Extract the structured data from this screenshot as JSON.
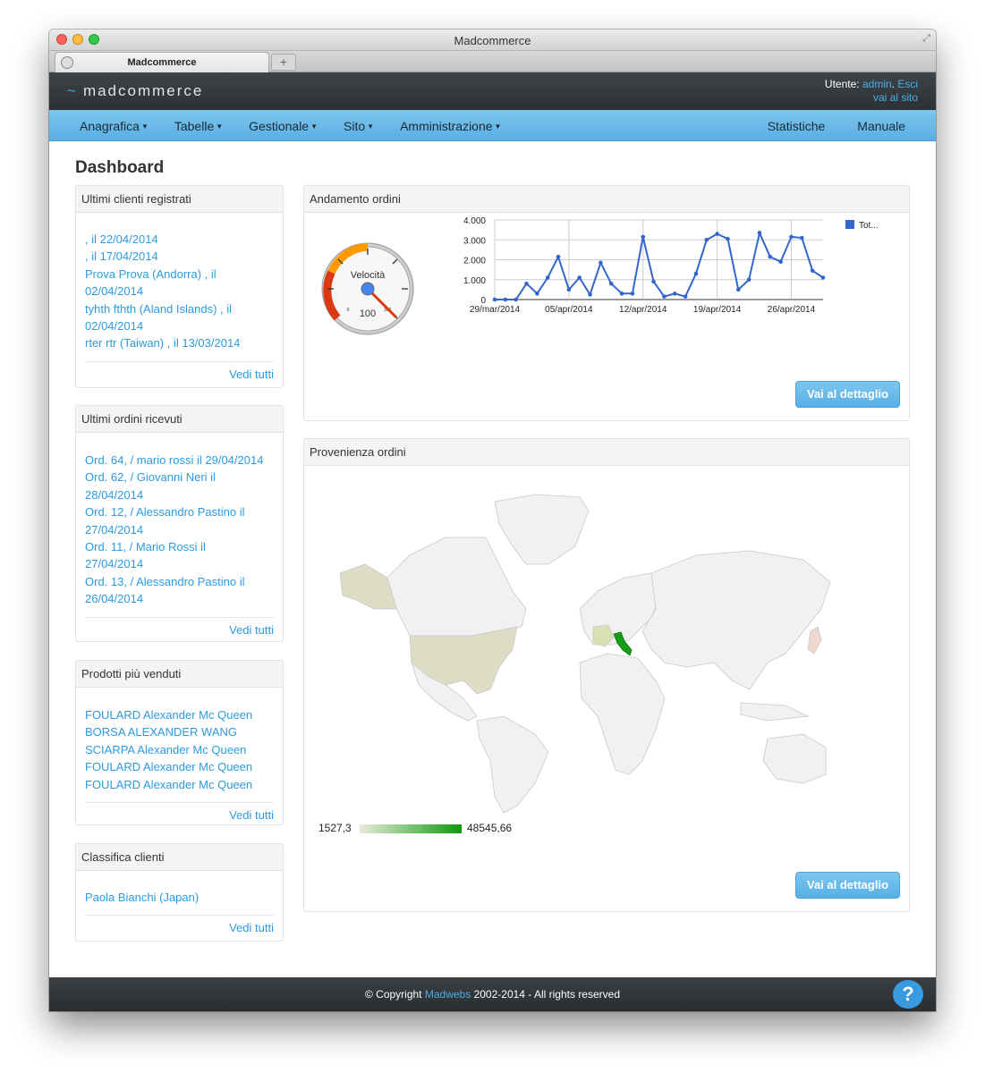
{
  "window": {
    "title": "Madcommerce",
    "tab_label": "Madcommerce",
    "new_tab": "+"
  },
  "header": {
    "logo": "madcommerce",
    "logo_prefix": "~",
    "user_label": "Utente:",
    "user_name": "admin",
    "logout": "Esci",
    "visit_site": "vai al sito"
  },
  "nav": {
    "left": [
      "Anagrafica",
      "Tabelle",
      "Gestionale",
      "Sito",
      "Amministrazione"
    ],
    "right": [
      "Statistiche",
      "Manuale"
    ]
  },
  "page_title": "Dashboard",
  "panels": {
    "clients": {
      "title": "Ultimi clienti registrati",
      "lines": [
        ", il 22/04/2014",
        ", il 17/04/2014",
        "Prova Prova (Andorra) , il",
        "02/04/2014",
        "tyhth fthth (Aland Islands) , il",
        "02/04/2014",
        "rter rtr (Taiwan) , il 13/03/2014"
      ],
      "footer": "Vedi tutti"
    },
    "orders": {
      "title": "Ultimi ordini ricevuti",
      "lines": [
        "Ord. 64, / mario rossi il 29/04/2014",
        "Ord. 62, / Giovanni Neri il",
        "28/04/2014",
        "Ord. 12, / Alessandro Pastino il",
        "27/04/2014",
        "Ord. 11, / Mario Rossi il",
        "27/04/2014",
        "Ord. 13, / Alessandro Pastino il",
        "26/04/2014"
      ],
      "footer": "Vedi tutti"
    },
    "products": {
      "title": "Prodotti più venduti",
      "lines": [
        "FOULARD Alexander Mc Queen",
        "BORSA ALEXANDER WANG",
        "SCIARPA Alexander Mc Queen",
        "FOULARD Alexander Mc Queen",
        "FOULARD Alexander Mc Queen"
      ],
      "footer": "Vedi tutti"
    },
    "ranking": {
      "title": "Classifica clienti",
      "lines": [
        "Paola Bianchi (Japan)"
      ],
      "footer": "Vedi tutti"
    },
    "trend": {
      "title": "Andamento ordini",
      "button": "Vai al dettaglio"
    },
    "origin": {
      "title": "Provenienza ordini",
      "button": "Vai al dettaglio",
      "legend_min": "1527,3",
      "legend_max": "48545,66"
    }
  },
  "gauge": {
    "label": "Velocità",
    "value": "100",
    "min_label": "0",
    "max_label": "100"
  },
  "chart_data": {
    "type": "line",
    "legend": "Tot...",
    "color": "#3366cc",
    "ylim": [
      0,
      4000
    ],
    "y_ticks": [
      "4.000",
      "3.000",
      "2.000",
      "1.000",
      "0"
    ],
    "x_ticks": [
      "29/mar/2014",
      "05/apr/2014",
      "12/apr/2014",
      "19/apr/2014",
      "26/apr/2014"
    ],
    "values": [
      0,
      0,
      0,
      800,
      300,
      1100,
      2150,
      500,
      1100,
      250,
      1850,
      800,
      300,
      300,
      3150,
      900,
      150,
      300,
      150,
      1300,
      3000,
      3300,
      3050,
      500,
      1000,
      3350,
      2150,
      1900,
      3150,
      3100,
      1450,
      1100
    ]
  },
  "map_colors": {
    "usa": "#dfdcc6",
    "alaska": "#dfdcc6",
    "italy": "#169d16",
    "france": "#d9e0b2",
    "japan": "#f0d8ce",
    "land": "#f1f1f1"
  },
  "footer": {
    "prefix": "© Copyright",
    "company": "Madwebs",
    "suffix": "2002-2014 - All rights reserved"
  }
}
